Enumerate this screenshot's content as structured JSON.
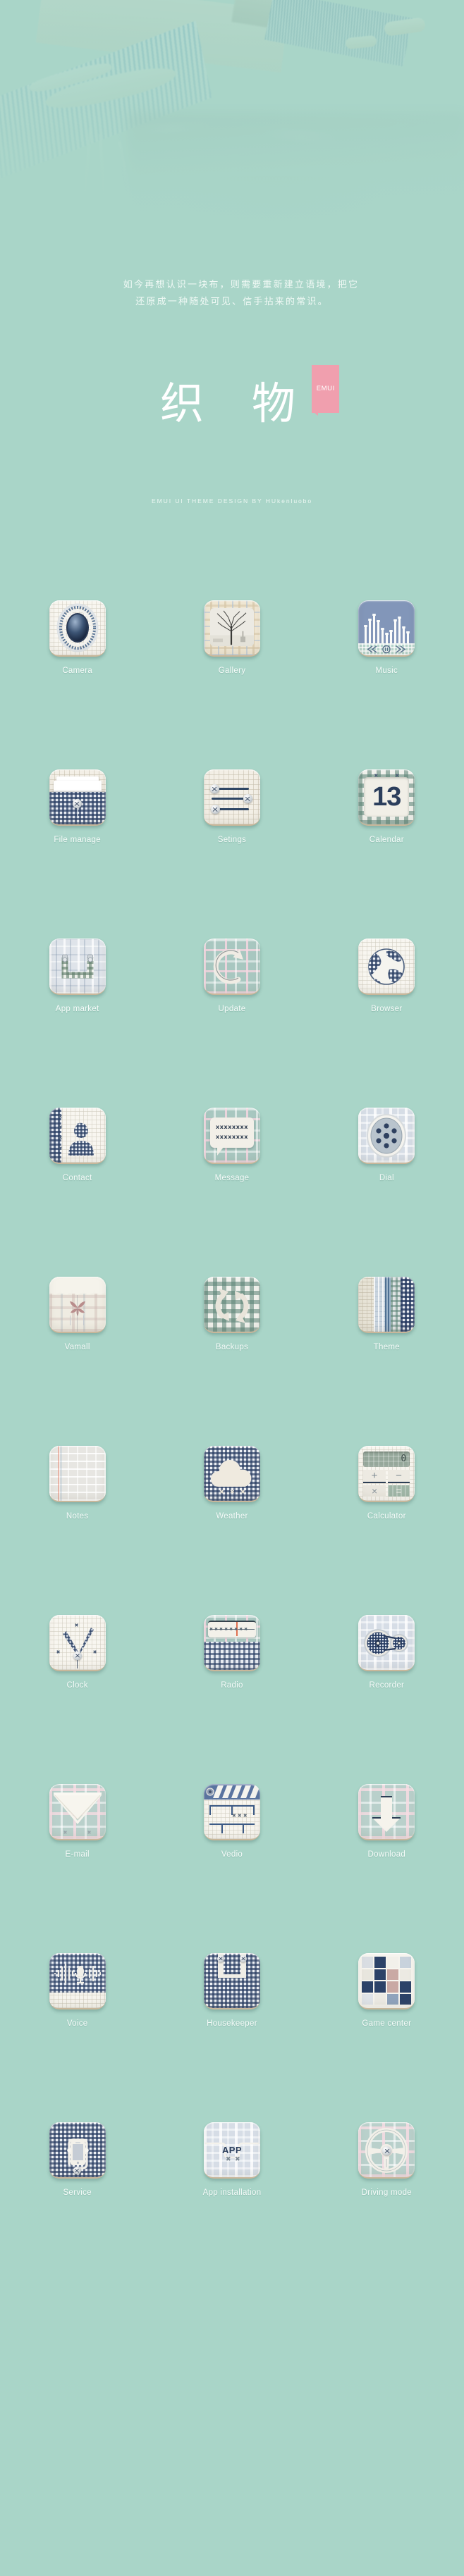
{
  "page": {
    "background_color": "#a9d5c8",
    "accent_color": "#f09fae",
    "label_color": "#f6fcfa"
  },
  "hero": {
    "image_description": "faded photograph of a hand weaving loom with blue striped cloth and a wooden shuttle"
  },
  "intro": {
    "line1": "如今再想认识一块布，则需要重新建立语境，把它",
    "line2": "还原成一种随处可见、信手拈来的常识。"
  },
  "title": {
    "text": "织 物",
    "badge": "EMUI",
    "subtitle": "EMUI UI THEME DESIGN BY HUkenluobo"
  },
  "grid": {
    "rows": [
      [
        {
          "label": "Camera",
          "icon": "camera-lens-icon"
        },
        {
          "label": "Gallery",
          "icon": "photo-frame-icon"
        },
        {
          "label": "Music",
          "icon": "equalizer-icon"
        }
      ],
      [
        {
          "label": "File  manage",
          "icon": "shirt-pocket-icon"
        },
        {
          "label": "Setings",
          "icon": "sliders-icon"
        },
        {
          "label": "Calendar",
          "icon": "calendar-icon",
          "day": "13"
        }
      ],
      [
        {
          "label": "App market",
          "icon": "suspenders-icon"
        },
        {
          "label": "Update",
          "icon": "refresh-arrow-icon"
        },
        {
          "label": "Browser",
          "icon": "globe-icon"
        }
      ],
      [
        {
          "label": "Contact",
          "icon": "person-card-icon"
        },
        {
          "label": "Message",
          "icon": "speech-bubble-icon",
          "bubble_line1": "xxxxxxxx",
          "bubble_line2": "xxxxxxxx"
        },
        {
          "label": "Dial",
          "icon": "dial-button-icon"
        }
      ],
      [
        {
          "label": "Vamall",
          "icon": "shop-awning-icon"
        },
        {
          "label": "Backups",
          "icon": "sync-arrows-icon"
        },
        {
          "label": "Theme",
          "icon": "fabric-swatch-icon"
        }
      ],
      [
        {
          "label": "Notes",
          "icon": "ruled-paper-icon"
        },
        {
          "label": "Weather",
          "icon": "cloud-icon"
        },
        {
          "label": "Calculator",
          "icon": "calculator-icon",
          "display": "0",
          "keys": [
            "+",
            "−",
            "×",
            "="
          ]
        }
      ],
      [
        {
          "label": "Clock",
          "icon": "clock-hands-icon"
        },
        {
          "label": "Radio",
          "icon": "radio-tuner-icon"
        },
        {
          "label": "Recorder",
          "icon": "tape-reels-icon"
        }
      ],
      [
        {
          "label": "E-mail",
          "icon": "envelope-icon"
        },
        {
          "label": "Vedio",
          "icon": "clapperboard-icon"
        },
        {
          "label": "Download",
          "icon": "download-arrow-icon"
        }
      ],
      [
        {
          "label": "Voice",
          "icon": "waveform-mic-icon"
        },
        {
          "label": "Housekeeper",
          "icon": "apron-icon"
        },
        {
          "label": "Game center",
          "icon": "tetris-blocks-icon"
        }
      ],
      [
        {
          "label": "Service",
          "icon": "phone-service-icon"
        },
        {
          "label": "App installation",
          "icon": "app-pocket-icon",
          "tag": "APP"
        },
        {
          "label": "Driving mode",
          "icon": "steering-wheel-icon"
        }
      ]
    ]
  }
}
